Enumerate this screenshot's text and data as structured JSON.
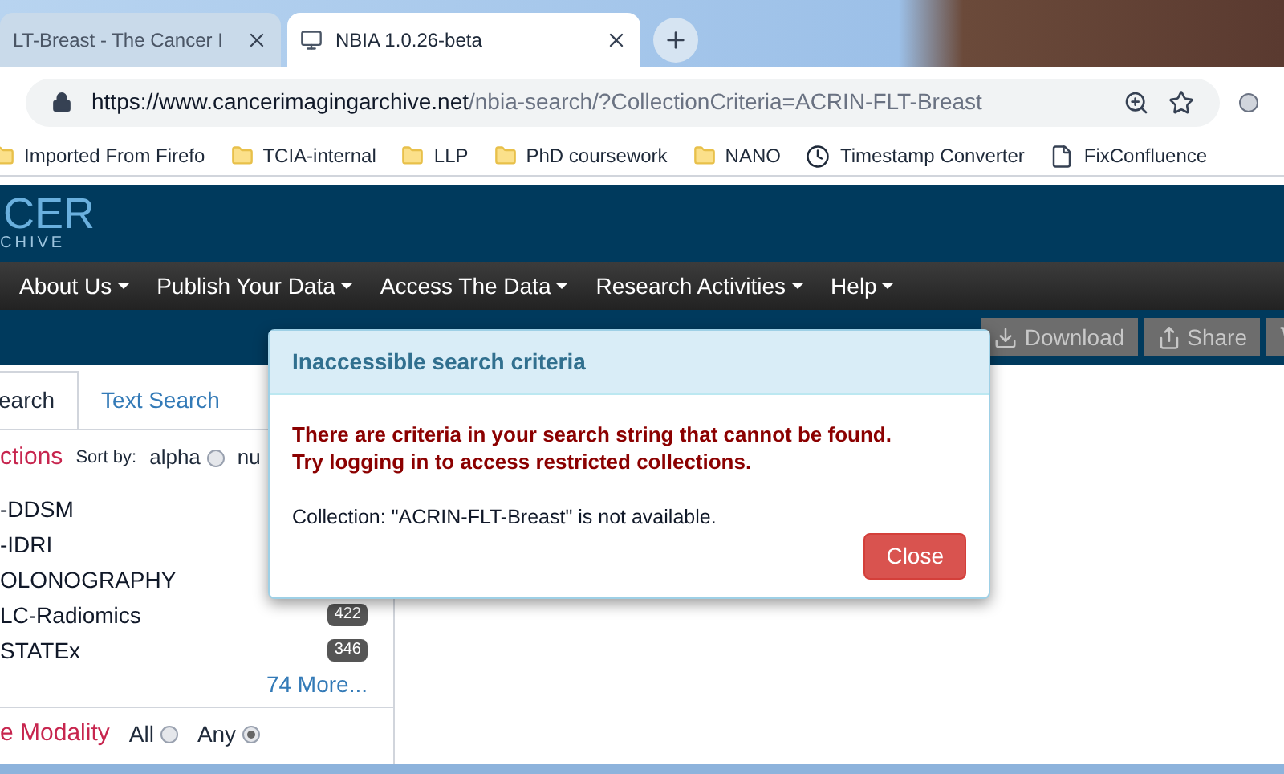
{
  "browser": {
    "tabs": [
      {
        "title": "LT-Breast - The Cancer I",
        "selected": false
      },
      {
        "title": "NBIA 1.0.26-beta",
        "selected": true
      }
    ],
    "address": {
      "host": "https://www.cancerimagingarchive.net",
      "path": "/nbia-search/?CollectionCriteria=ACRIN-FLT-Breast"
    },
    "bookmarks": [
      {
        "kind": "folder",
        "label": "Imported From Firefo"
      },
      {
        "kind": "folder",
        "label": "TCIA-internal"
      },
      {
        "kind": "folder",
        "label": "LLP"
      },
      {
        "kind": "folder",
        "label": "PhD coursework"
      },
      {
        "kind": "folder",
        "label": "NANO"
      },
      {
        "kind": "clock",
        "label": "Timestamp Converter"
      },
      {
        "kind": "page",
        "label": "FixConfluence"
      }
    ]
  },
  "site": {
    "logo": [
      "CER",
      "CHIVE"
    ],
    "nav": [
      "About Us",
      "Publish Your Data",
      "Access The Data",
      "Research Activities",
      "Help"
    ],
    "toolbar": [
      {
        "kind": "download",
        "label": "Download"
      },
      {
        "kind": "share",
        "label": "Share"
      },
      {
        "kind": "cart"
      }
    ]
  },
  "search_tabs": [
    {
      "label": "earch",
      "selected": true
    },
    {
      "label": "Text Search",
      "selected": false
    }
  ],
  "collections": {
    "title": "ctions",
    "sort_label": "Sort by:",
    "sort_options": [
      {
        "label": "alpha",
        "selected": false
      },
      {
        "label": "nu"
      }
    ],
    "items": [
      {
        "name": "-DDSM"
      },
      {
        "name": "-IDRI"
      },
      {
        "name": "OLONOGRAPHY"
      },
      {
        "name": "LC-Radiomics",
        "count": "422"
      },
      {
        "name": "STATEx",
        "count": "346"
      }
    ],
    "more": "74 More..."
  },
  "modality": {
    "title": "e Modality",
    "options": [
      {
        "label": "All",
        "selected": false
      },
      {
        "label": "Any",
        "selected": true
      }
    ]
  },
  "dialog": {
    "title": "Inaccessible search criteria",
    "warning": [
      "There are criteria in your search string that cannot be found.",
      "Try logging in to access restricted collections."
    ],
    "message": "Collection: \"ACRIN-FLT-Breast\" is not available.",
    "button": "Close"
  }
}
